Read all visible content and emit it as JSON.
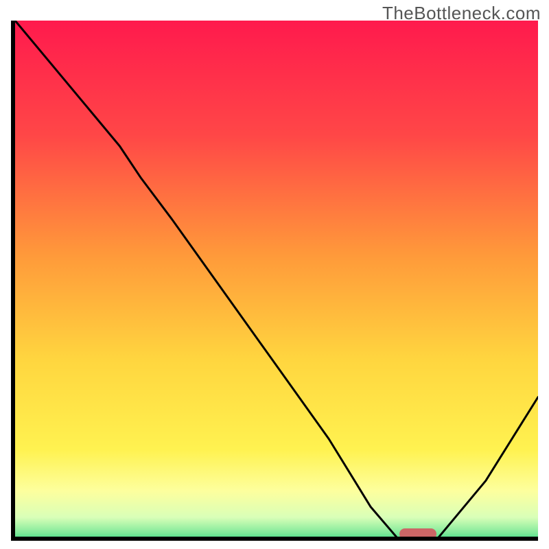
{
  "watermark": "TheBottleneck.com",
  "chart_data": {
    "type": "line",
    "title": "",
    "xlabel": "",
    "ylabel": "",
    "xlim": [
      0,
      100
    ],
    "ylim": [
      0,
      100
    ],
    "grid": false,
    "legend": false,
    "series": [
      {
        "name": "curve",
        "x": [
          0,
          10,
          20,
          24,
          30,
          40,
          50,
          60,
          68,
          74,
          80,
          90,
          100
        ],
        "y": [
          100,
          88,
          76,
          70,
          62,
          48,
          34,
          20,
          7,
          0,
          0,
          12,
          28
        ]
      }
    ],
    "marker": {
      "x": 77,
      "y": 0.5
    },
    "gradient_stops": [
      {
        "pct": 0,
        "color": "#ff1a4d"
      },
      {
        "pct": 22,
        "color": "#ff4747"
      },
      {
        "pct": 45,
        "color": "#ff9a3a"
      },
      {
        "pct": 65,
        "color": "#ffd63f"
      },
      {
        "pct": 82,
        "color": "#fff250"
      },
      {
        "pct": 90,
        "color": "#fdff9e"
      },
      {
        "pct": 95,
        "color": "#d9ffb8"
      },
      {
        "pct": 98,
        "color": "#7fe99a"
      },
      {
        "pct": 100,
        "color": "#1fd47a"
      }
    ]
  }
}
